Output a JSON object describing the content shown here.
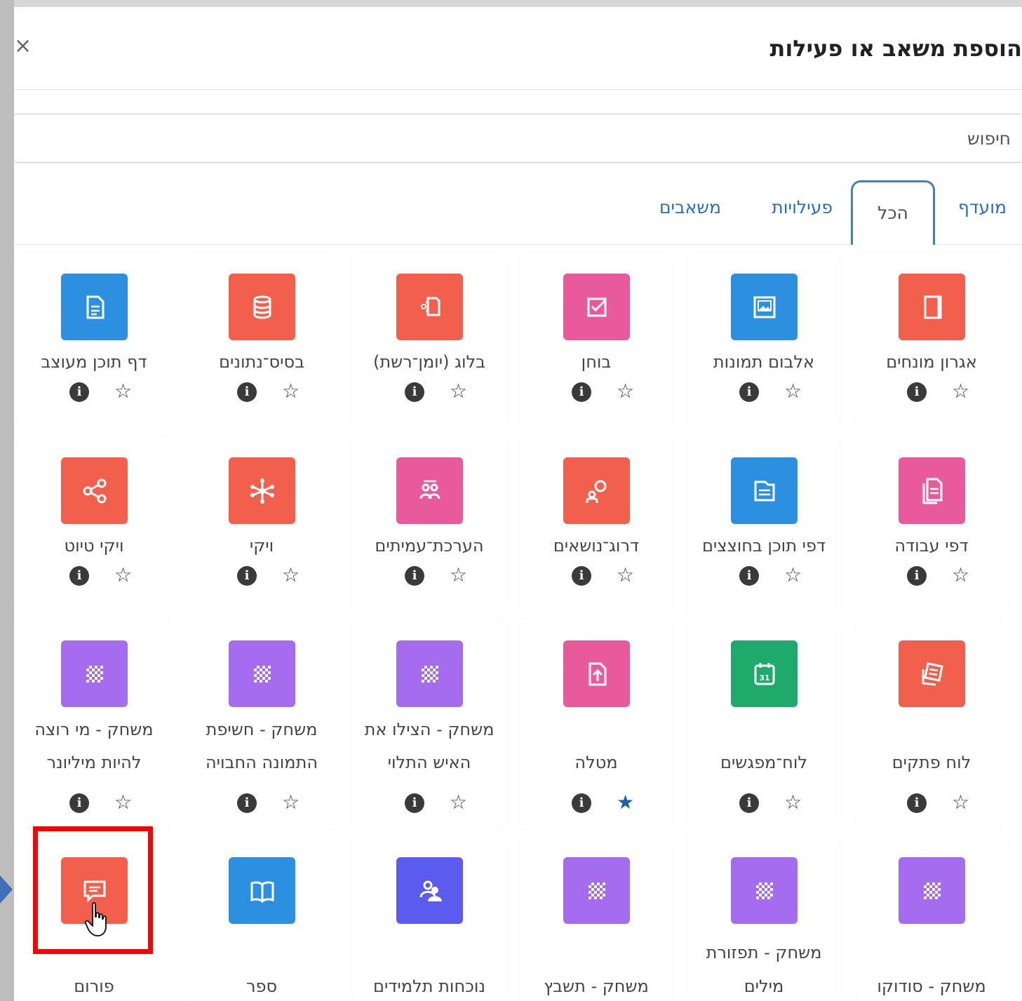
{
  "modal": {
    "title": "הוספת משאב או פעילות",
    "close_glyph": "×"
  },
  "search": {
    "placeholder": "חיפוש"
  },
  "tabs": [
    "מועדף",
    "הכל",
    "פעילויות",
    "משאבים"
  ],
  "active_tab": "הכל",
  "row1": [
    {
      "label": "אגרון מונחים",
      "icon": "notebook-icon",
      "color": "#f25f4c",
      "starred": false
    },
    {
      "label": "אלבום תמונות",
      "icon": "photo-album-icon",
      "color": "#2d8fe0",
      "starred": false
    },
    {
      "label": "בוחן",
      "icon": "quiz-checkbox-icon",
      "color": "#e85a9b",
      "starred": false
    },
    {
      "label": "בלוג (יומן־רשת)",
      "icon": "blog-icon",
      "color": "#f25f4c",
      "starred": false
    },
    {
      "label": "בסיס־נתונים",
      "icon": "database-icon",
      "color": "#f25f4c",
      "starred": false
    },
    {
      "label": "דף תוכן מעוצב",
      "icon": "document-icon",
      "color": "#2d8fe0",
      "starred": false
    }
  ],
  "row2": [
    {
      "label": "דפי עבודה",
      "icon": "worksheets-icon",
      "color": "#e85a9b",
      "starred": false
    },
    {
      "label": "דפי תוכן בחוצצים",
      "icon": "tabbed-pages-icon",
      "color": "#2d8fe0",
      "starred": false
    },
    {
      "label": "דרוג־נושאים",
      "icon": "rate-topics-icon",
      "color": "#f25f4c",
      "starred": false
    },
    {
      "label": "הערכת־עמיתים",
      "icon": "peer-review-icon",
      "color": "#e85a9b",
      "starred": false
    },
    {
      "label": "ויקי",
      "icon": "wiki-icon",
      "color": "#f25f4c",
      "starred": false
    },
    {
      "label": "ויקי טיוט",
      "icon": "share-icon",
      "color": "#f25f4c",
      "starred": false
    }
  ],
  "row3": [
    {
      "label1": "",
      "label2": "לוח פתקים",
      "icon": "sticky-notes-icon",
      "color": "#f25f4c",
      "starred": false
    },
    {
      "label1": "",
      "label2": "לוח־מפגשים",
      "icon": "calendar-icon",
      "color": "#1faa6b",
      "starred": false
    },
    {
      "label1": "",
      "label2": "מטלה",
      "icon": "assignment-upload-icon",
      "color": "#e85a9b",
      "starred": true
    },
    {
      "label1": "משחק - הצילו את",
      "label2": "האיש התלוי",
      "icon": "game-grid-icon",
      "color": "#a66cf0",
      "starred": false
    },
    {
      "label1": "משחק - חשיפת",
      "label2": "התמונה החבויה",
      "icon": "game-grid-icon",
      "color": "#a66cf0",
      "starred": false
    },
    {
      "label1": "משחק - מי רוצה",
      "label2": "להיות מיליונר",
      "icon": "game-grid-icon",
      "color": "#a66cf0",
      "starred": false
    }
  ],
  "row4": [
    {
      "label1": "",
      "label2": "משחק - סודוקו",
      "icon": "game-grid-icon",
      "color": "#a66cf0"
    },
    {
      "label1": "משחק - תפזורת",
      "label2": "מילים",
      "icon": "game-grid-icon",
      "color": "#a66cf0"
    },
    {
      "label1": "",
      "label2": "משחק - תשבץ",
      "icon": "game-grid-icon",
      "color": "#a66cf0"
    },
    {
      "label1": "",
      "label2": "נוכחות תלמידים",
      "icon": "attendance-icon",
      "color": "#5b5bf0"
    },
    {
      "label1": "",
      "label2": "ספר",
      "icon": "book-icon",
      "color": "#2d8fe0"
    },
    {
      "label1": "",
      "label2": "פורום",
      "icon": "forum-icon",
      "color": "#f25f4c"
    }
  ],
  "glyphs": {
    "info": "i",
    "star_empty": "☆",
    "star_filled": "★"
  }
}
